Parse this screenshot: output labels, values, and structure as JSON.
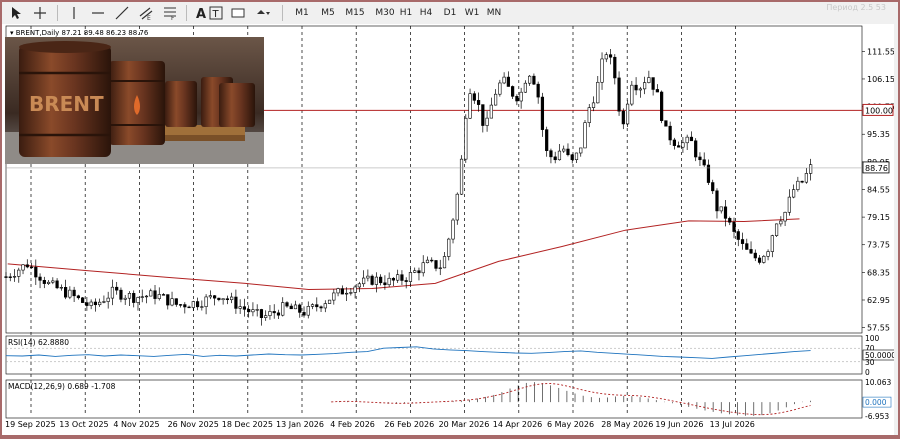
{
  "toolbar": {
    "timeframes": [
      "M1",
      "M5",
      "M15",
      "M30",
      "H1",
      "H4",
      "D1",
      "W1",
      "MN"
    ],
    "tools": [
      "cursor-icon",
      "crosshair-icon",
      "vertical-line-icon",
      "horizontal-line-icon",
      "trendline-icon",
      "channel-icon",
      "fibonacci-icon",
      "text-tool-icon",
      "text-label-icon",
      "rectangle-icon",
      "shapes-dropdown-icon"
    ],
    "watermark": "Период 2.5 53"
  },
  "colors": {
    "bull": "#ffffff",
    "bear": "#000000",
    "ma": "#b22222",
    "rsi": "#1e73be",
    "level": "#b22222",
    "price_tag_bg": "#ffffff",
    "level_tag_bg": "#ffffff"
  },
  "chart_data": {
    "type": "candlestick",
    "symbol_line": "BRENT,Daily  87.21 89.48 86.23 88.76",
    "price_axis": [
      "111.55",
      "106.15",
      "100.75",
      "95.35",
      "89.95",
      "84.55",
      "79.15",
      "73.75",
      "68.35",
      "62.95",
      "57.55"
    ],
    "ylim": [
      56.5,
      116.5
    ],
    "date_labels": [
      "19 Sep 2025",
      "13 Oct 2025",
      "4 Nov 2025",
      "26 Nov 2025",
      "18 Dec 2025",
      "13 Jan 2026",
      "4 Feb 2026",
      "26 Feb 2026",
      "20 Mar 2026",
      "14 Apr 2026",
      "6 May 2026",
      "28 May 2026",
      "19 Jun 2026",
      "13 Jul 2026"
    ],
    "current_price": "88.76",
    "horizontal_level": {
      "value": 100.0,
      "label": "100.00"
    },
    "ma_points": [
      [
        0,
        70.0
      ],
      [
        0.1,
        68.7
      ],
      [
        0.2,
        67.4
      ],
      [
        0.3,
        66.2
      ],
      [
        0.38,
        65.0
      ],
      [
        0.46,
        65.2
      ],
      [
        0.54,
        66.2
      ],
      [
        0.62,
        70.5
      ],
      [
        0.7,
        73.4
      ],
      [
        0.78,
        76.6
      ],
      [
        0.86,
        78.4
      ],
      [
        0.93,
        78.3
      ],
      [
        1.0,
        78.8
      ]
    ],
    "close_points": [
      [
        0,
        67.5
      ],
      [
        0.025,
        70.0
      ],
      [
        0.05,
        66.0
      ],
      [
        0.075,
        64.0
      ],
      [
        0.1,
        61.5
      ],
      [
        0.125,
        64.5
      ],
      [
        0.15,
        63.5
      ],
      [
        0.175,
        64.0
      ],
      [
        0.2,
        62.0
      ],
      [
        0.225,
        62.5
      ],
      [
        0.25,
        64.0
      ],
      [
        0.275,
        61.5
      ],
      [
        0.3,
        59.5
      ],
      [
        0.325,
        61.5
      ],
      [
        0.35,
        60.5
      ],
      [
        0.37,
        62.5
      ],
      [
        0.39,
        64.5
      ],
      [
        0.41,
        66.0
      ],
      [
        0.43,
        67.0
      ],
      [
        0.45,
        66.5
      ],
      [
        0.47,
        67.5
      ],
      [
        0.49,
        70.0
      ],
      [
        0.51,
        69.5
      ],
      [
        0.52,
        77.0
      ],
      [
        0.53,
        86.0
      ],
      [
        0.54,
        105.0
      ],
      [
        0.55,
        102.0
      ],
      [
        0.56,
        96.0
      ],
      [
        0.57,
        103.0
      ],
      [
        0.58,
        106.0
      ],
      [
        0.59,
        103.5
      ],
      [
        0.6,
        102.5
      ],
      [
        0.61,
        108.0
      ],
      [
        0.62,
        105.0
      ],
      [
        0.63,
        92.0
      ],
      [
        0.64,
        90.5
      ],
      [
        0.65,
        93.0
      ],
      [
        0.66,
        89.5
      ],
      [
        0.67,
        92.0
      ],
      [
        0.68,
        100.0
      ],
      [
        0.69,
        104.0
      ],
      [
        0.7,
        112.0
      ],
      [
        0.71,
        108.0
      ],
      [
        0.72,
        96.0
      ],
      [
        0.73,
        106.0
      ],
      [
        0.74,
        104.5
      ],
      [
        0.75,
        107.0
      ],
      [
        0.76,
        103.5
      ],
      [
        0.77,
        96.0
      ],
      [
        0.78,
        94.0
      ],
      [
        0.79,
        93.5
      ],
      [
        0.8,
        94.0
      ],
      [
        0.81,
        90.0
      ],
      [
        0.82,
        87.0
      ],
      [
        0.83,
        81.0
      ],
      [
        0.84,
        79.5
      ],
      [
        0.85,
        76.0
      ],
      [
        0.86,
        73.5
      ],
      [
        0.87,
        71.5
      ],
      [
        0.88,
        71.0
      ],
      [
        0.89,
        73.0
      ],
      [
        0.9,
        78.5
      ],
      [
        0.91,
        80.0
      ],
      [
        0.92,
        84.5
      ],
      [
        0.93,
        86.0
      ],
      [
        0.94,
        88.76
      ]
    ],
    "rsi": {
      "label": "RSI(14) 62.8880",
      "axis": [
        "100",
        "70",
        "50.0000",
        "30",
        "0"
      ],
      "levels": [
        70,
        30
      ],
      "current": 62.888,
      "values": [
        48,
        47,
        50,
        46,
        49,
        51,
        47,
        50,
        48,
        46,
        49,
        52,
        46,
        49,
        47,
        50,
        53,
        51,
        50,
        52,
        54,
        58,
        60,
        70,
        72,
        74,
        68,
        65,
        63,
        60,
        58,
        56,
        55,
        57,
        60,
        62,
        58,
        55,
        52,
        49,
        46,
        44,
        42,
        40,
        44,
        48,
        52,
        56,
        60,
        62.888
      ]
    },
    "macd": {
      "label": "MACD(12,26,9) 0.689 -1.708",
      "axis": [
        "10.063",
        "0.000",
        "-6.953"
      ],
      "range": [
        -6.953,
        10.063
      ],
      "hist": [
        0.2,
        0.4,
        0.5,
        0.3,
        0.1,
        -0.2,
        -0.5,
        -0.8,
        -0.9,
        -0.7,
        -0.5,
        -0.3,
        -0.1,
        0.2,
        0.3,
        0.5,
        0.8,
        1.2,
        1.8,
        2.6,
        3.6,
        5.0,
        6.8,
        8.4,
        9.6,
        10.0,
        9.5,
        8.4,
        7.1,
        5.6,
        4.3,
        3.2,
        2.5,
        2.1,
        2.3,
        2.8,
        3.1,
        3.0,
        2.5,
        1.8,
        1.0,
        0.2,
        -0.6,
        -1.5,
        -2.4,
        -3.3,
        -4.2,
        -4.9,
        -5.6,
        -6.1,
        -6.6,
        -6.8,
        -6.9,
        -6.5,
        -5.6,
        -4.2,
        -2.6,
        -1.0,
        0.2,
        0.689
      ],
      "signal": [
        0.1,
        0.3,
        0.4,
        0.3,
        0.1,
        -0.1,
        -0.3,
        -0.5,
        -0.6,
        -0.6,
        -0.5,
        -0.3,
        -0.1,
        0.1,
        0.3,
        0.5,
        0.8,
        1.1,
        1.6,
        2.3,
        3.1,
        4.0,
        5.2,
        6.4,
        7.6,
        8.6,
        9.2,
        9.3,
        8.9,
        8.0,
        7.0,
        6.0,
        5.1,
        4.4,
        3.9,
        3.6,
        3.4,
        3.3,
        3.1,
        2.7,
        2.1,
        1.4,
        0.6,
        -0.2,
        -1.0,
        -1.9,
        -2.7,
        -3.5,
        -4.2,
        -4.9,
        -5.4,
        -5.9,
        -6.2,
        -6.3,
        -6.1,
        -5.6,
        -4.8,
        -3.8,
        -2.7,
        -1.708
      ]
    }
  },
  "thumbnail": {
    "text": "BRENT"
  }
}
